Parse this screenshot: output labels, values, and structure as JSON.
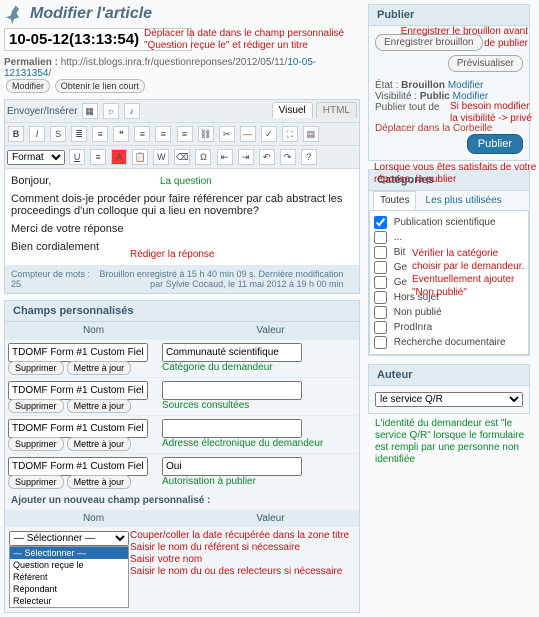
{
  "header": {
    "title": "Modifier l'article"
  },
  "title_input": "10-05-12(13:13:54)",
  "permalink": {
    "label": "Permalien :",
    "url_left": "http://ist.blogs.inra.fr/questionreponses/2012/05/11/",
    "url_slug": "10-05-12131354",
    "modify_btn": "Modifier",
    "shortlink_btn": "Obtenir le lien court"
  },
  "editor": {
    "insert_label": "Envoyer/Insérer",
    "tab_visual": "Visuel",
    "tab_html": "HTML",
    "format_label": "Format",
    "content": {
      "p1": "Bonjour,",
      "p2": "Comment dois-je procéder pour faire référencer par cab abstract les proceedings d'un colloque qui a lieu en novembre?",
      "p3": "Merci de votre réponse",
      "p4": "Bien cordialement"
    },
    "status": {
      "words_label": "Compteur de mots : 25",
      "draft": "Brouillon enregistré à 15 h 40 min 09 s. Dernière modification par Sylvie Cocaud, le 11 mai 2012 à 19 h 00 min"
    }
  },
  "custom_fields": {
    "panel_title": "Champs personnalisés",
    "col_name": "Nom",
    "col_value": "Valeur",
    "rows": [
      {
        "name": "TDOMF Form #1 Custom Fielc",
        "value": "Communauté scientifique",
        "annot": "Catégorie du demandeur"
      },
      {
        "name": "TDOMF Form #1 Custom Fielc",
        "value": "",
        "annot": "Sources consultées"
      },
      {
        "name": "TDOMF Form #1 Custom Fielc",
        "value": "",
        "annot": "Adresse électronique du demandeur"
      },
      {
        "name": "TDOMF Form #1 Custom Fielc",
        "value": "Oui",
        "annot": "Autorisation à publier"
      }
    ],
    "delete_btn": "Supprimer",
    "update_btn": "Mettre à jour",
    "add_title": "Ajouter un nouveau champ personnalisé :",
    "select_placeholder": "— Sélectionner —",
    "options": [
      "— Sélectionner —",
      "Question reçue le",
      "Référent",
      "Répondant",
      "Relecteur"
    ]
  },
  "publish_box": {
    "title": "Publier",
    "save_draft": "Enregistrer brouillon",
    "preview": "Prévisualiser",
    "status_label": "État :",
    "status_value": "Brouillon",
    "modify": "Modifier",
    "visibility_label": "Visibilité :",
    "visibility_value": "Public",
    "publish_all": "Publier tout de",
    "trash": "Déplacer dans la Corbeille",
    "publish_btn": "Publier"
  },
  "categories": {
    "title": "Catégories",
    "tab_all": "Toutes",
    "tab_most": "Les plus utilisées",
    "items": [
      {
        "label": "Publication scientifique",
        "checked": true,
        "prefix": ""
      },
      {
        "label": "...",
        "checked": false,
        "prefix": ""
      },
      {
        "label": "Bit",
        "checked": false,
        "prefix": ""
      },
      {
        "label": "Ge",
        "checked": false,
        "prefix": ""
      },
      {
        "label": "Ge",
        "checked": false,
        "prefix": ""
      },
      {
        "label": "Hors sujet",
        "checked": false,
        "prefix": ""
      },
      {
        "label": "Non publié",
        "checked": false,
        "prefix": ""
      },
      {
        "label": "ProdInra",
        "checked": false,
        "prefix": ""
      },
      {
        "label": "Recherche documentaire",
        "checked": false,
        "prefix": ""
      }
    ]
  },
  "author_box": {
    "title": "Auteur",
    "value": "le service Q/R"
  },
  "annotations": {
    "a1": "Déplacer la date dans le champ personnalisé \"Question reçue le\" et rédiger un titre",
    "a2": "Enregistrer le brouillon avant de publier",
    "a3": "Si besoin modifier la visibilité -> privé",
    "a4": "Lorsque vous êtes satisfaits de votre réponse, la publier",
    "a5": "La question",
    "a6": "Rédiger la réponse",
    "a7": "Vérifier la catégorie",
    "a7b": "choisir par le demandeur.",
    "a7c": "Eventuellement ajouter",
    "a7d": "\"Non publié\"",
    "a8": "L'identité du demandeur est \"le service Q/R\" lorsque le formulaire est rempli par une personne non identifiée",
    "a9": "Couper/coller la date récupérée dans la zone titre",
    "a10": "Saisir le nom du référent si nécessaire",
    "a11": "Saisir votre nom",
    "a12": "Saisir le nom du ou des relecteurs si nécessaire"
  }
}
